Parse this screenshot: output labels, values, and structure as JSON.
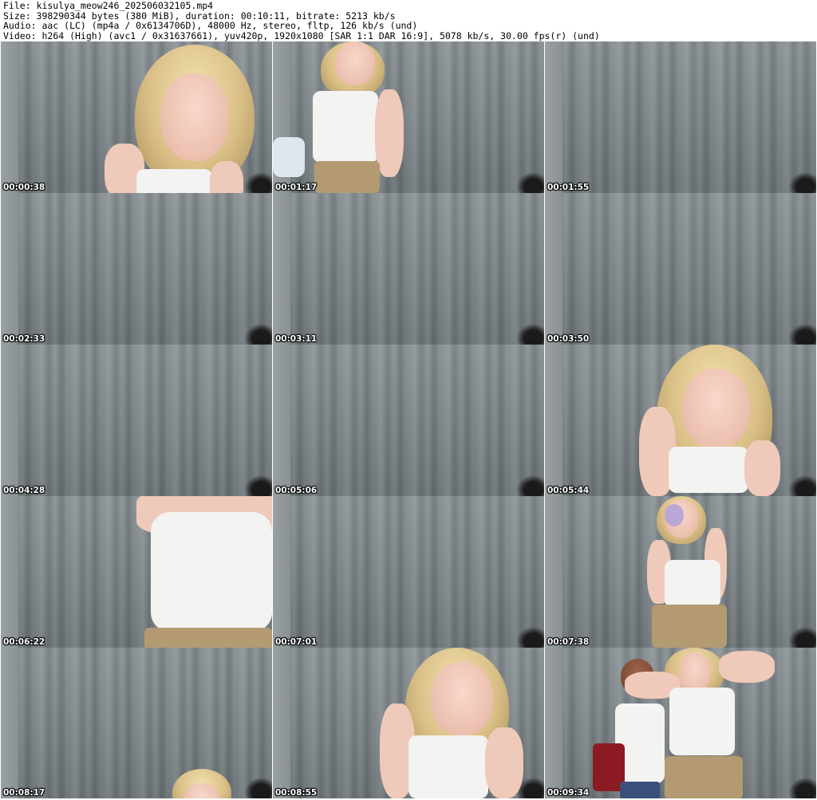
{
  "header": {
    "file_line": "File: kisulya_meow246_202506032105.mp4",
    "size_line": "Size: 398290344 bytes (380 MiB), duration: 00:10:11, bitrate: 5213 kb/s",
    "audio_line": "Audio: aac (LC) (mp4a / 0x6134706D), 48000 Hz, stereo, fltp, 126 kb/s (und)",
    "video_line": "Video: h264 (High) (avc1 / 0x31637661), yuv420p, 1920x1080 [SAR 1:1 DAR 16:9], 5078 kb/s, 30.00 fps(r) (und)"
  },
  "frames": [
    {
      "timestamp": "00:00:38"
    },
    {
      "timestamp": "00:01:17"
    },
    {
      "timestamp": "00:01:55"
    },
    {
      "timestamp": "00:02:33"
    },
    {
      "timestamp": "00:03:11"
    },
    {
      "timestamp": "00:03:50"
    },
    {
      "timestamp": "00:04:28"
    },
    {
      "timestamp": "00:05:06"
    },
    {
      "timestamp": "00:05:44"
    },
    {
      "timestamp": "00:06:22"
    },
    {
      "timestamp": "00:07:01"
    },
    {
      "timestamp": "00:07:38"
    },
    {
      "timestamp": "00:08:17"
    },
    {
      "timestamp": "00:08:55"
    },
    {
      "timestamp": "00:09:34"
    }
  ]
}
